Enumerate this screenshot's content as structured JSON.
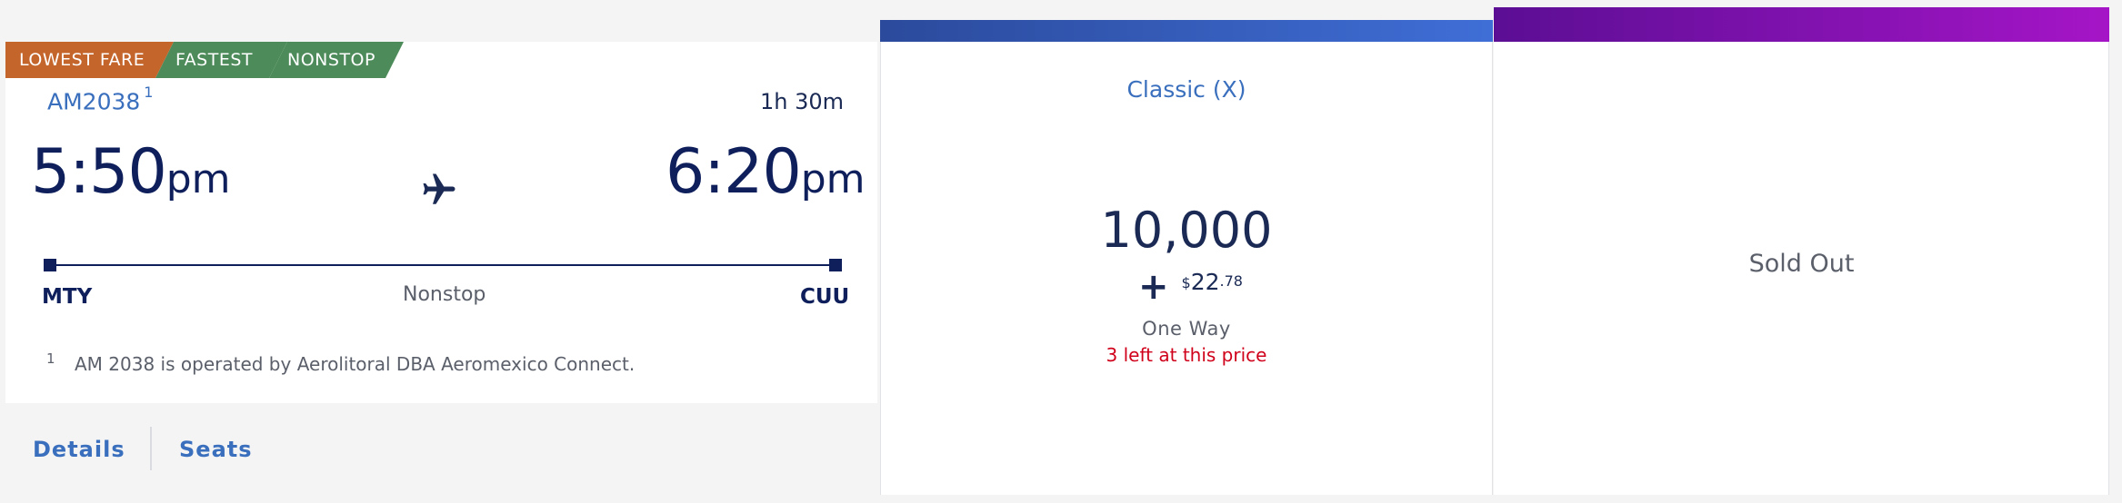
{
  "flight": {
    "badges": [
      "LOWEST FARE",
      "FASTEST",
      "NONSTOP"
    ],
    "number": "AM2038",
    "footnote_marker": "1",
    "duration": "1h 30m",
    "departure": {
      "time": "5:50",
      "ampm": "pm",
      "airport": "MTY"
    },
    "arrival": {
      "time": "6:20",
      "ampm": "pm",
      "airport": "CUU"
    },
    "stops": "Nonstop",
    "plane_icon": "airplane-icon",
    "footnote_number": "1",
    "footnote_text": "AM 2038 is operated by Aerolitoral DBA Aeromexico Connect.",
    "links": {
      "details": "Details",
      "seats": "Seats"
    }
  },
  "fares": [
    {
      "cabin": "Classic (X)",
      "miles": "10,000",
      "plus": "+",
      "currency_symbol": "$",
      "amount_whole": "22",
      "amount_cents": ".78",
      "trip_type": "One Way",
      "availability": "3 left at this price",
      "accent": "#3f6ed6"
    },
    {
      "status": "Sold Out",
      "accent": "#a515c7"
    }
  ],
  "colors": {
    "navy": "#0e1f5b",
    "link_blue": "#3a6fbd",
    "alert_red": "#d0021b",
    "badge_orange": "#c4652c",
    "badge_green": "#4d8b5a"
  }
}
